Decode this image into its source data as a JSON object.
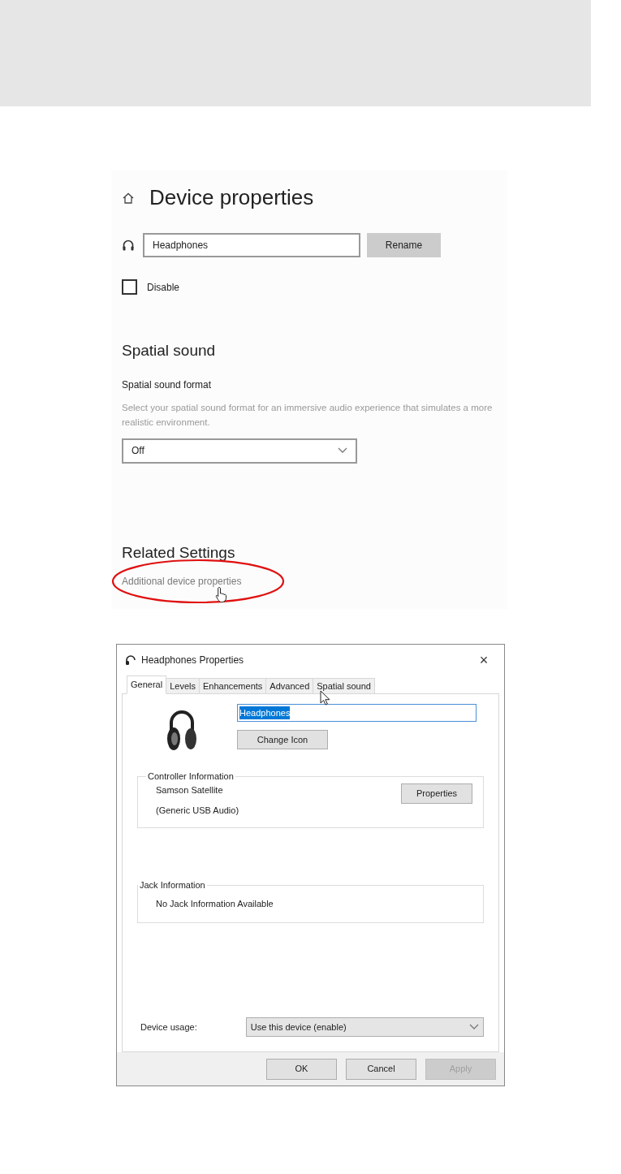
{
  "settings": {
    "title": "Device properties",
    "name_field": {
      "value": "Headphones"
    },
    "rename_button": "Rename",
    "disable": {
      "label": "Disable",
      "checked": false
    },
    "spatial": {
      "heading": "Spatial sound",
      "format_label": "Spatial sound format",
      "description": "Select your spatial sound format for an immersive audio experience that simulates a more realistic environment.",
      "dropdown": {
        "value": "Off"
      }
    },
    "related": {
      "heading": "Related Settings",
      "link": "Additional device properties"
    }
  },
  "dialog": {
    "title": "Headphones Properties",
    "close": "×",
    "tabs": [
      {
        "label": "General",
        "selected": true
      },
      {
        "label": "Levels",
        "selected": false
      },
      {
        "label": "Enhancements",
        "selected": false
      },
      {
        "label": "Advanced",
        "selected": false
      },
      {
        "label": "Spatial sound",
        "selected": false
      }
    ],
    "name_field": {
      "value": "Headphones",
      "text_selected": true
    },
    "change_icon_button": "Change Icon",
    "controller": {
      "label": "Controller Information",
      "name": "Samson Satellite",
      "driver": "(Generic USB Audio)",
      "button": "Properties"
    },
    "jack": {
      "label": "Jack Information",
      "text": "No Jack Information Available"
    },
    "device_usage": {
      "label": "Device usage:",
      "value": "Use this device (enable)"
    },
    "buttons": [
      {
        "label": "OK",
        "disabled": false
      },
      {
        "label": "Cancel",
        "disabled": false
      },
      {
        "label": "Apply",
        "disabled": true
      }
    ]
  }
}
